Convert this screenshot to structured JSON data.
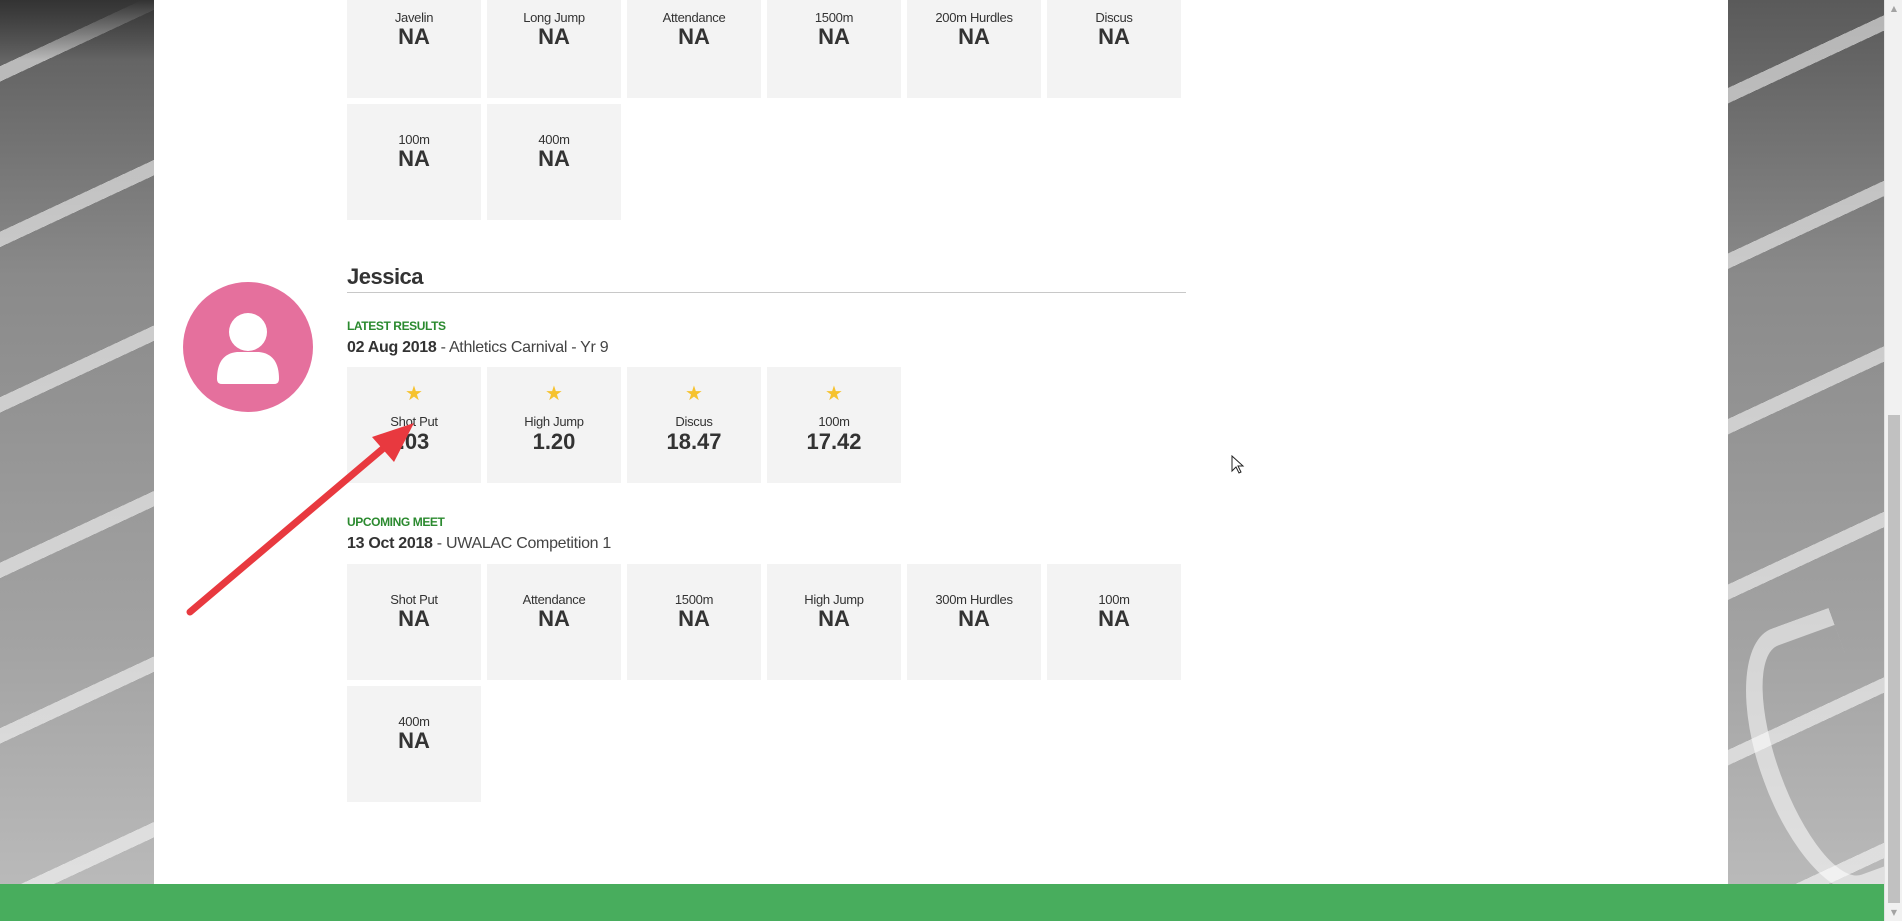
{
  "colors": {
    "accent_green": "#48ad5d",
    "heading_green": "#2b8a2f",
    "avatar_pink": "#e5709d",
    "star_gold": "#f6c22d",
    "tile_bg": "#f3f3f3",
    "annotation_arrow": "#e8393f"
  },
  "previous_athlete": {
    "upcoming_tiles": [
      {
        "event": "Javelin",
        "value": "NA"
      },
      {
        "event": "Long Jump",
        "value": "NA"
      },
      {
        "event": "Attendance",
        "value": "NA"
      },
      {
        "event": "1500m",
        "value": "NA"
      },
      {
        "event": "200m Hurdles",
        "value": "NA"
      },
      {
        "event": "Discus",
        "value": "NA"
      },
      {
        "event": "100m",
        "value": "NA"
      },
      {
        "event": "400m",
        "value": "NA"
      }
    ]
  },
  "athlete": {
    "name": "Jessica",
    "avatar_icon": "user-icon",
    "latest_results": {
      "heading": "LATEST RESULTS",
      "date": "02 Aug 2018",
      "separator": " - ",
      "meet": "Athletics Carnival - Yr 9",
      "tiles": [
        {
          "icon": "star-icon",
          "event": "Shot Put",
          "value": "5.03",
          "visible_value": ".03"
        },
        {
          "icon": "star-icon",
          "event": "High Jump",
          "value": "1.20"
        },
        {
          "icon": "star-icon",
          "event": "Discus",
          "value": "18.47"
        },
        {
          "icon": "star-icon",
          "event": "100m",
          "value": "17.42"
        }
      ]
    },
    "upcoming_meet": {
      "heading": "UPCOMING MEET",
      "date": "13 Oct 2018",
      "separator": " - ",
      "meet": "UWALAC Competition 1",
      "tiles": [
        {
          "event": "Shot Put",
          "value": "NA"
        },
        {
          "event": "Attendance",
          "value": "NA"
        },
        {
          "event": "1500m",
          "value": "NA"
        },
        {
          "event": "High Jump",
          "value": "NA"
        },
        {
          "event": "300m Hurdles",
          "value": "NA"
        },
        {
          "event": "100m",
          "value": "NA"
        },
        {
          "event": "400m",
          "value": "NA"
        }
      ]
    }
  },
  "scrollbar": {
    "up_glyph": "▲",
    "down_glyph": "▼"
  }
}
